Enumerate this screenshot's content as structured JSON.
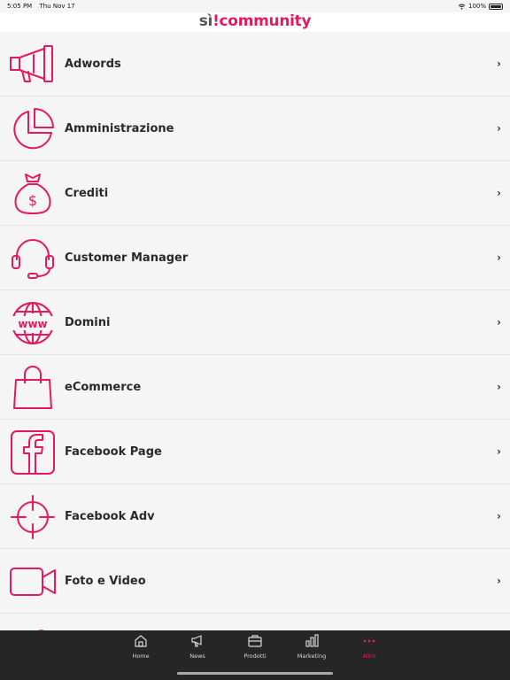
{
  "status": {
    "time": "5:05 PM",
    "date": "Thu Nov 17",
    "battery": "100%"
  },
  "header": {
    "logo_si": "sì",
    "logo_bang": "!",
    "logo_community": "community"
  },
  "menu": [
    {
      "label": "Adwords",
      "icon": "megaphone-icon"
    },
    {
      "label": "Amministrazione",
      "icon": "pie-chart-icon"
    },
    {
      "label": "Crediti",
      "icon": "money-bag-icon"
    },
    {
      "label": "Customer Manager",
      "icon": "headset-icon"
    },
    {
      "label": "Domini",
      "icon": "globe-www-icon"
    },
    {
      "label": "eCommerce",
      "icon": "shopping-bag-icon"
    },
    {
      "label": "Facebook Page",
      "icon": "facebook-icon"
    },
    {
      "label": "Facebook Adv",
      "icon": "crosshair-icon"
    },
    {
      "label": "Foto e Video",
      "icon": "video-camera-icon"
    }
  ],
  "chevron": "›",
  "tabs": [
    {
      "label": "Home",
      "icon": "home-icon"
    },
    {
      "label": "News",
      "icon": "megaphone-icon"
    },
    {
      "label": "Prodotti",
      "icon": "briefcase-icon"
    },
    {
      "label": "Marketing",
      "icon": "bar-chart-icon"
    },
    {
      "label": "Altro",
      "icon": "more-dots-icon",
      "active": true
    }
  ],
  "colors": {
    "accent": "#e5195f",
    "tabbar": "#262626",
    "background": "#f5f5f5"
  }
}
